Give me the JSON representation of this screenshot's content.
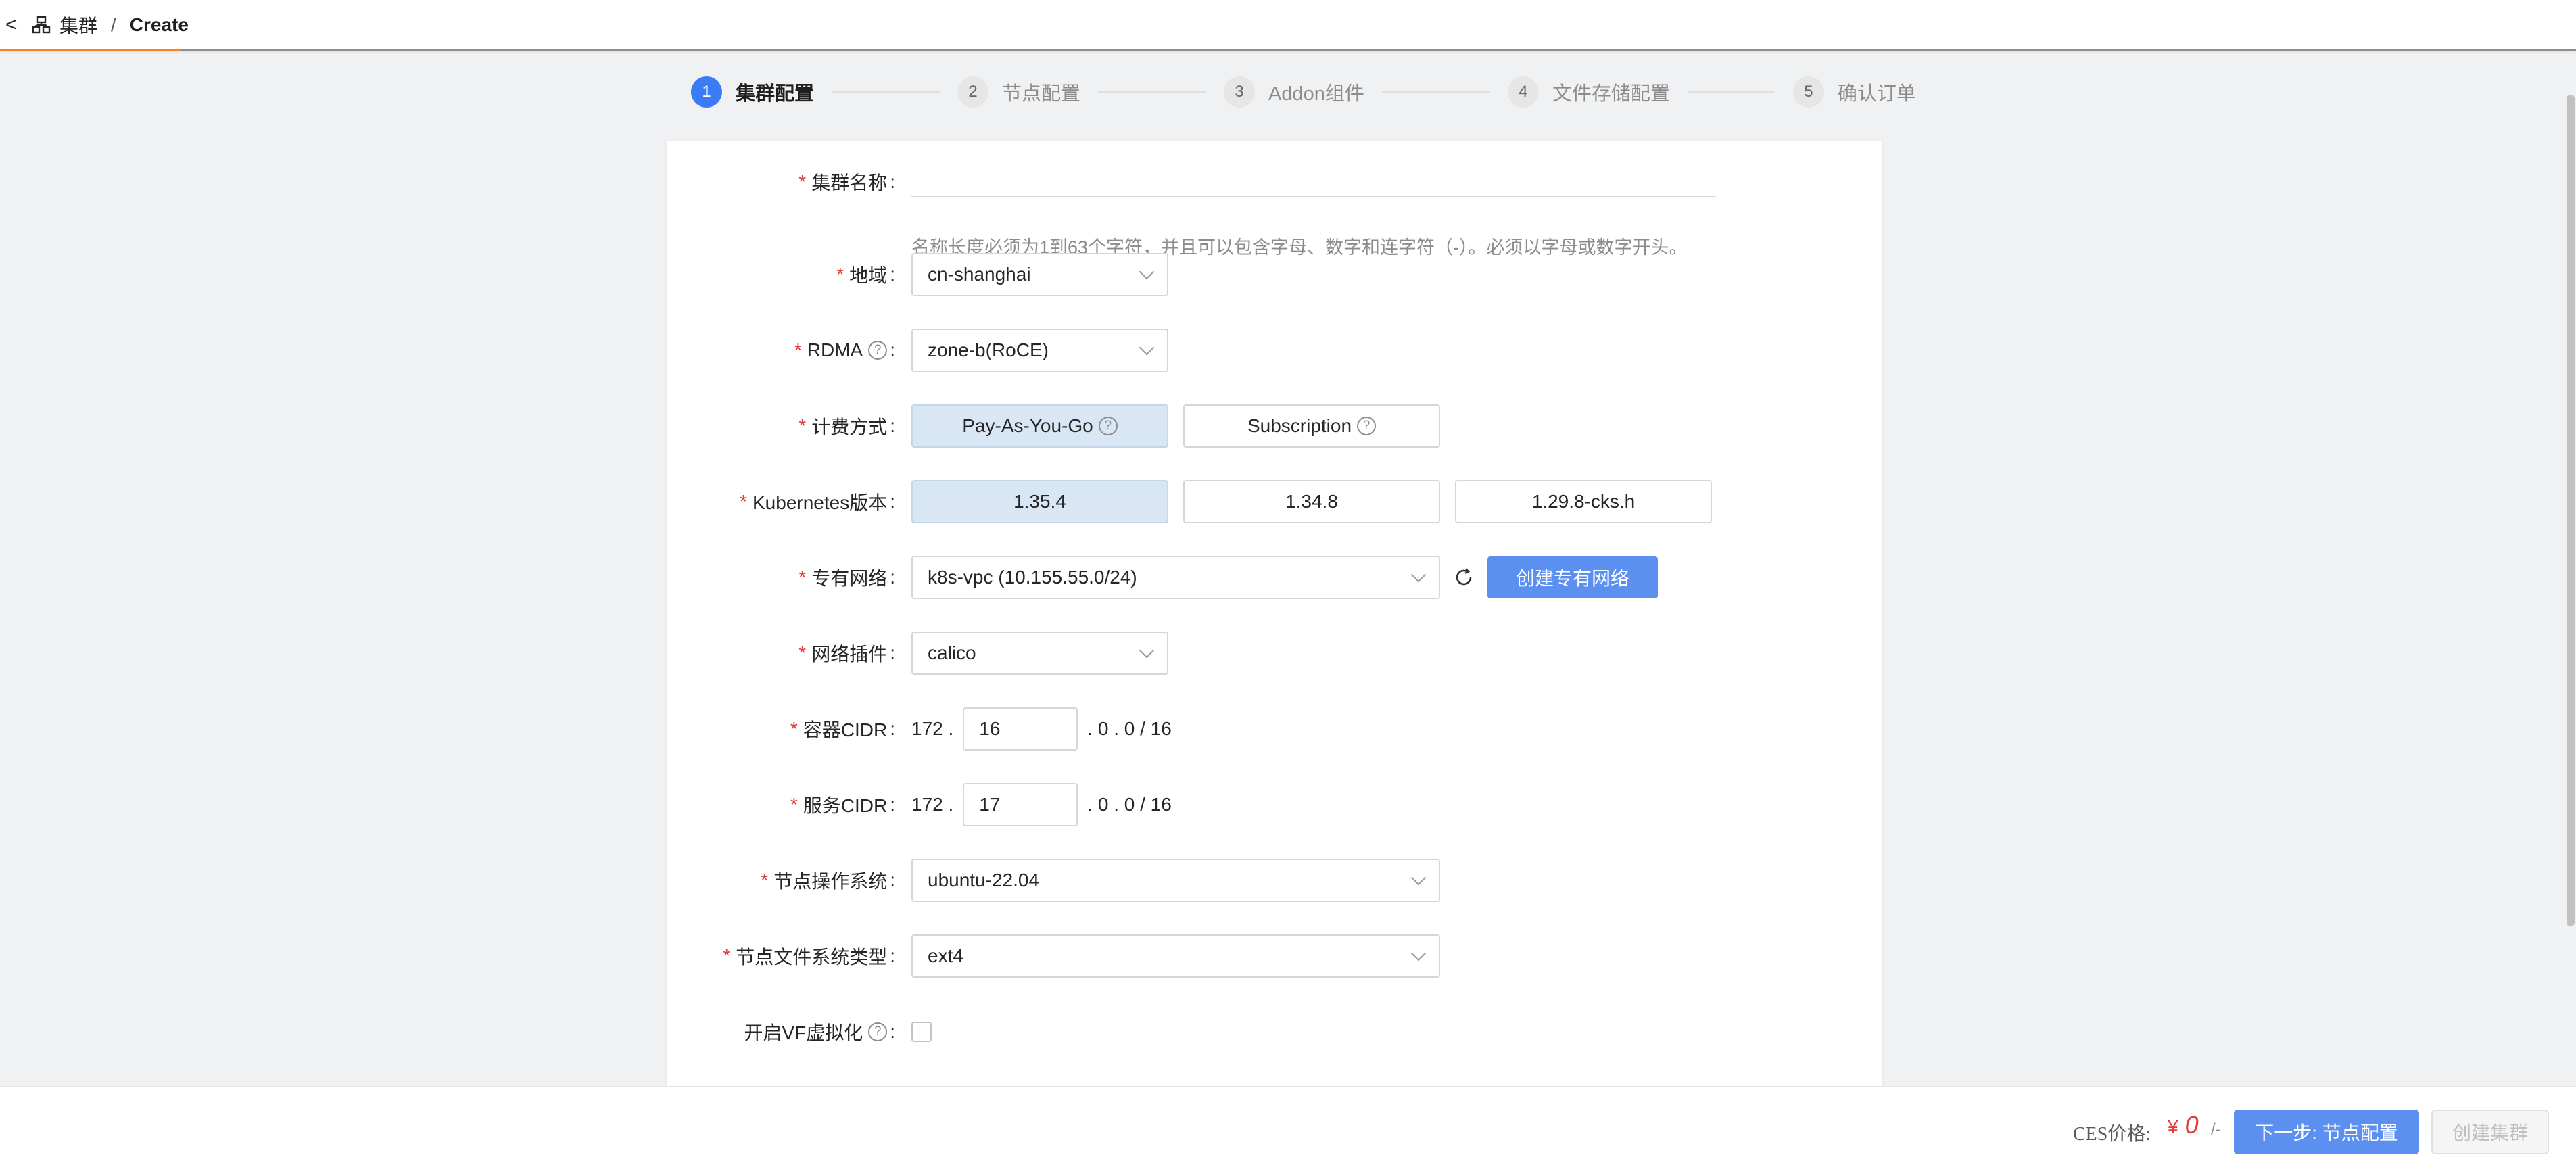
{
  "header": {
    "back_glyph": "<",
    "parent": "集群",
    "separator": "/",
    "current": "Create"
  },
  "steps": [
    {
      "num": "1",
      "label": "集群配置",
      "active": true
    },
    {
      "num": "2",
      "label": "节点配置",
      "active": false
    },
    {
      "num": "3",
      "label": "Addon组件",
      "active": false
    },
    {
      "num": "4",
      "label": "文件存储配置",
      "active": false
    },
    {
      "num": "5",
      "label": "确认订单",
      "active": false
    }
  ],
  "form": {
    "required_mark": "*",
    "cluster_name": {
      "label": "集群名称",
      "value": "",
      "hint": "名称长度必须为1到63个字符，并且可以包含字母、数字和连字符（-）。必须以字母或数字开头。"
    },
    "region": {
      "label": "地域",
      "value": "cn-shanghai"
    },
    "rdma": {
      "label": "RDMA",
      "value": "zone-b(RoCE)"
    },
    "billing": {
      "label": "计费方式",
      "options": [
        "Pay-As-You-Go",
        "Subscription"
      ],
      "selected": "Pay-As-You-Go"
    },
    "k8s_version": {
      "label": "Kubernetes版本",
      "options": [
        "1.35.4",
        "1.34.8",
        "1.29.8-cks.h"
      ],
      "selected": "1.35.4"
    },
    "vpc": {
      "label": "专有网络",
      "value": "k8s-vpc (10.155.55.0/24)",
      "create_button": "创建专有网络"
    },
    "network_plugin": {
      "label": "网络插件",
      "value": "calico"
    },
    "pod_cidr": {
      "label": "容器CIDR",
      "prefix": "172 .",
      "value": "16",
      "suffix": ". 0 . 0 / 16"
    },
    "service_cidr": {
      "label": "服务CIDR",
      "prefix": "172 .",
      "value": "17",
      "suffix": ". 0 . 0 / 16"
    },
    "node_os": {
      "label": "节点操作系统",
      "value": "ubuntu-22.04"
    },
    "node_fs": {
      "label": "节点文件系统类型",
      "value": "ext4"
    },
    "vf": {
      "label": "开启VF虚拟化",
      "checked": false
    }
  },
  "footer": {
    "price_label": "CES价格:",
    "currency": "¥",
    "price": "0",
    "unit": "/-",
    "next_button": "下一步: 节点配置",
    "create_button": "创建集群"
  },
  "colors": {
    "primary": "#5b8ff0",
    "active_step": "#3b7cf5",
    "selected_option_bg": "#d9e7f5",
    "required": "#e53935",
    "accent_orange": "#f5841f"
  }
}
